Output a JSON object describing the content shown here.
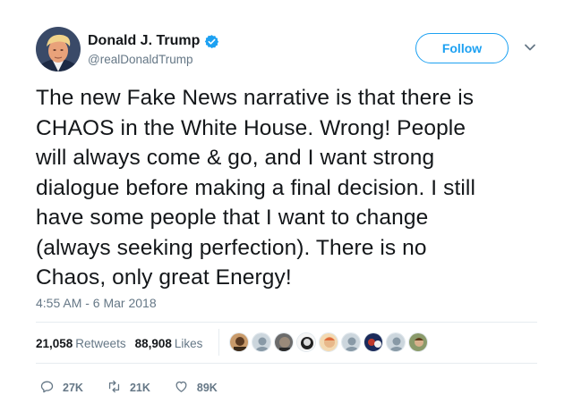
{
  "author": {
    "display_name": "Donald J. Trump",
    "handle": "@realDonaldTrump",
    "verified": true
  },
  "follow_label": "Follow",
  "tweet": {
    "lines": [
      "The new Fake News narrative is that there is",
      "CHAOS in the White House. Wrong! People",
      "will always come & go, and I want strong",
      "dialogue before making a final decision. I still",
      "have some people that I want to change",
      "(always seeking perfection). There is no",
      "Chaos, only great Energy!"
    ],
    "timestamp": "4:55 AM - 6 Mar 2018"
  },
  "stats": {
    "retweets_count": "21,058",
    "retweets_label": "Retweets",
    "likes_count": "88,908",
    "likes_label": "Likes"
  },
  "actions": {
    "replies": "27K",
    "retweets": "21K",
    "likes": "89K"
  },
  "colors": {
    "accent": "#1da1f2",
    "secondary_text": "#657786",
    "divider": "#e6ecf0"
  },
  "icons": {
    "verified": "verified-badge-icon",
    "caret": "chevron-down-icon",
    "reply": "reply-icon",
    "retweet": "retweet-icon",
    "like": "heart-icon"
  }
}
